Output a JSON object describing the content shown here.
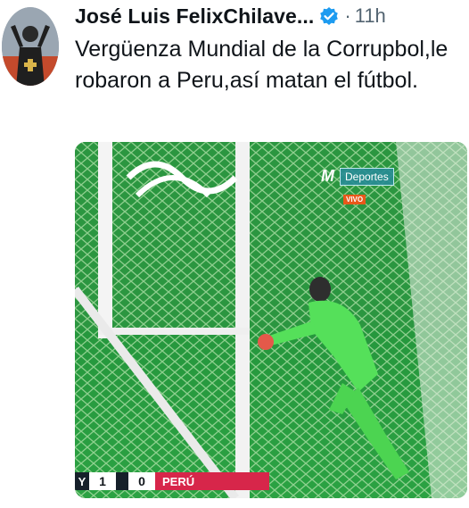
{
  "tweet": {
    "author_name": "José Luis FelixChilave...",
    "separator": "·",
    "time": "11h",
    "text": "Vergüenza Mundial de la Corrupbol,le robaron a Peru,así matan el fútbol."
  },
  "media": {
    "broadcaster_logo": "M",
    "broadcaster_label": "Deportes",
    "live_badge": "VIVO",
    "score": {
      "left_team": "Y",
      "left_score": "1",
      "right_score": "0",
      "right_team": "PERÚ"
    }
  },
  "colors": {
    "verified": "#1d9bf0",
    "pitch": "#2f8f3a",
    "keeper_kit": "#55e05a",
    "score_red": "#d7264a"
  }
}
